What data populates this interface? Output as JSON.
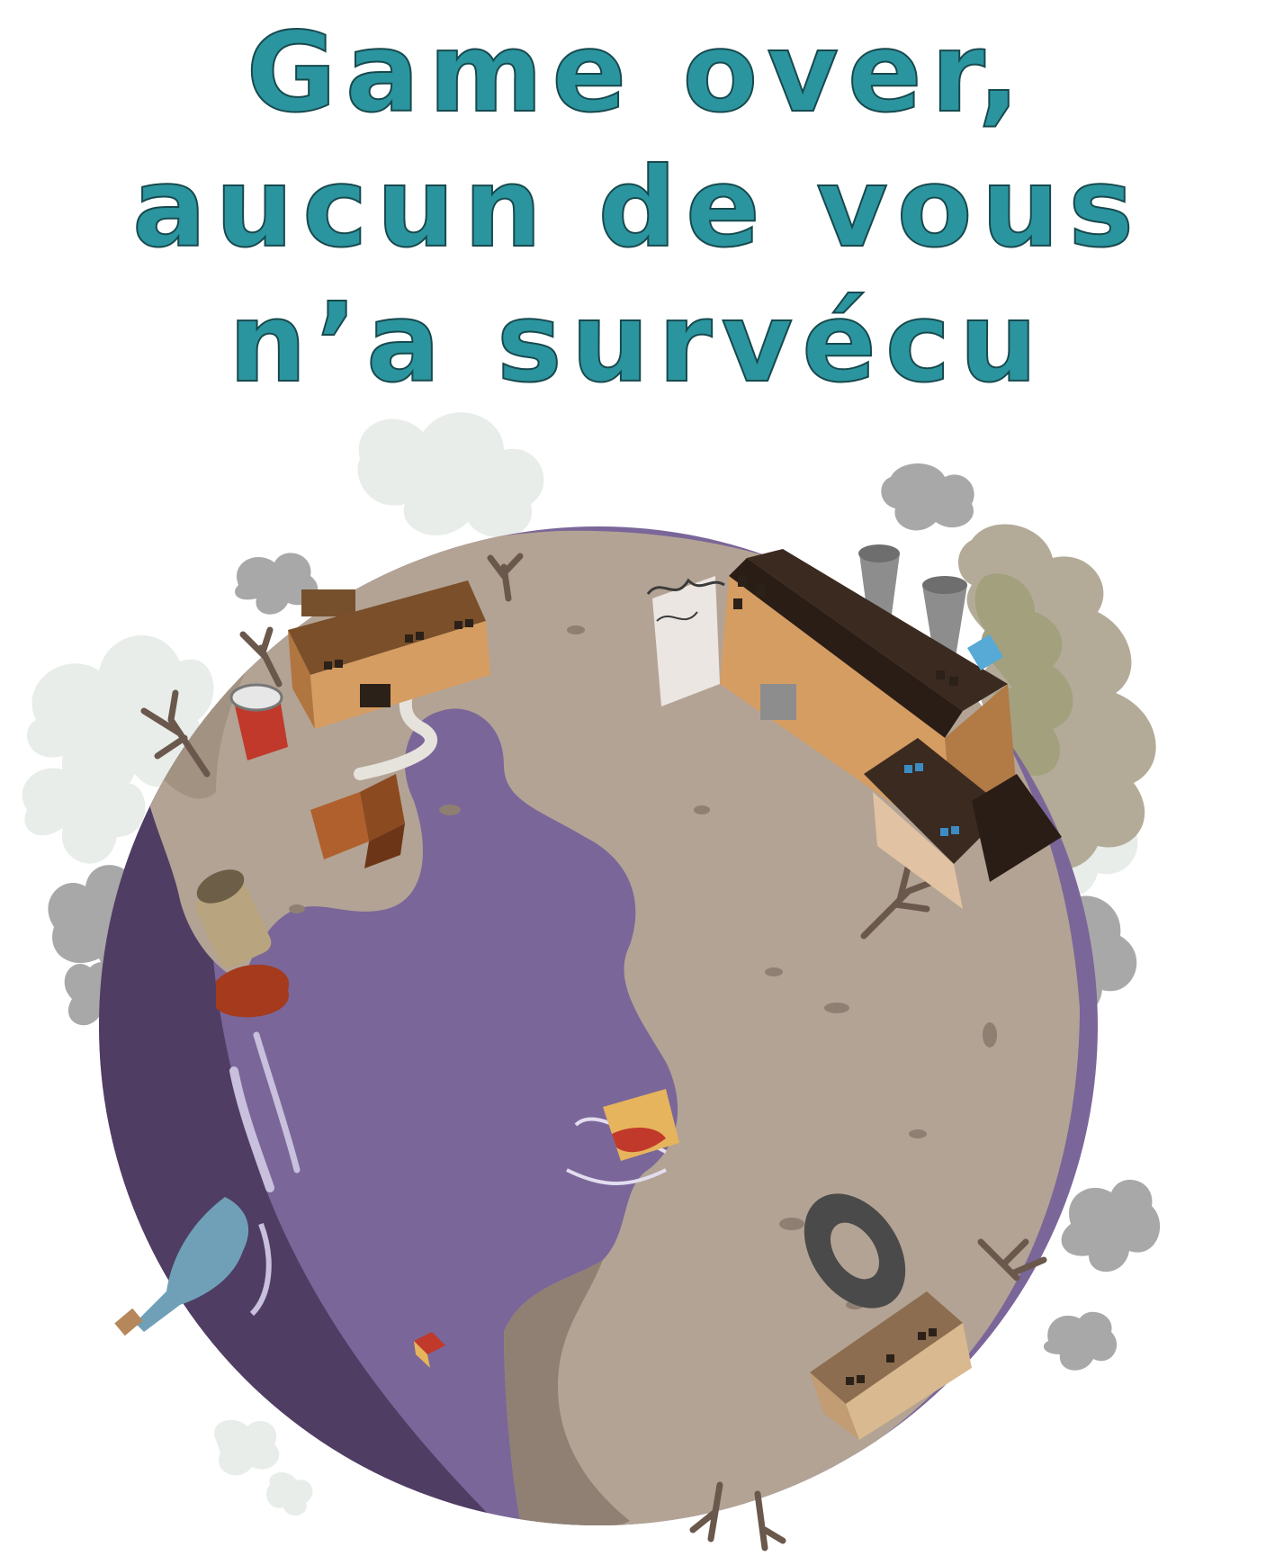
{
  "screen": {
    "title_lines": [
      "Game over,",
      "aucun de vous",
      "n’a survécu"
    ]
  },
  "illustration": {
    "subject": "polluted-earth",
    "elements": [
      "smoke-cloud",
      "factory",
      "house",
      "dead-tree",
      "oil-barrel",
      "oil-spill",
      "trash-can",
      "bottle",
      "tire",
      "floating-cup",
      "barbed-wire",
      "ocean",
      "land"
    ]
  },
  "colors": {
    "title": "#2b959f",
    "title_outline": "#17494e",
    "ocean": "#7b6799",
    "ocean_shadow": "#4e3c61",
    "land": "#b2a293",
    "land_shadow": "#8c7d70",
    "smoke": "#a6a6a6",
    "pale_smoke": "#e8ece8",
    "green_smoke": "#a9aa86",
    "building": "#d69d63"
  }
}
